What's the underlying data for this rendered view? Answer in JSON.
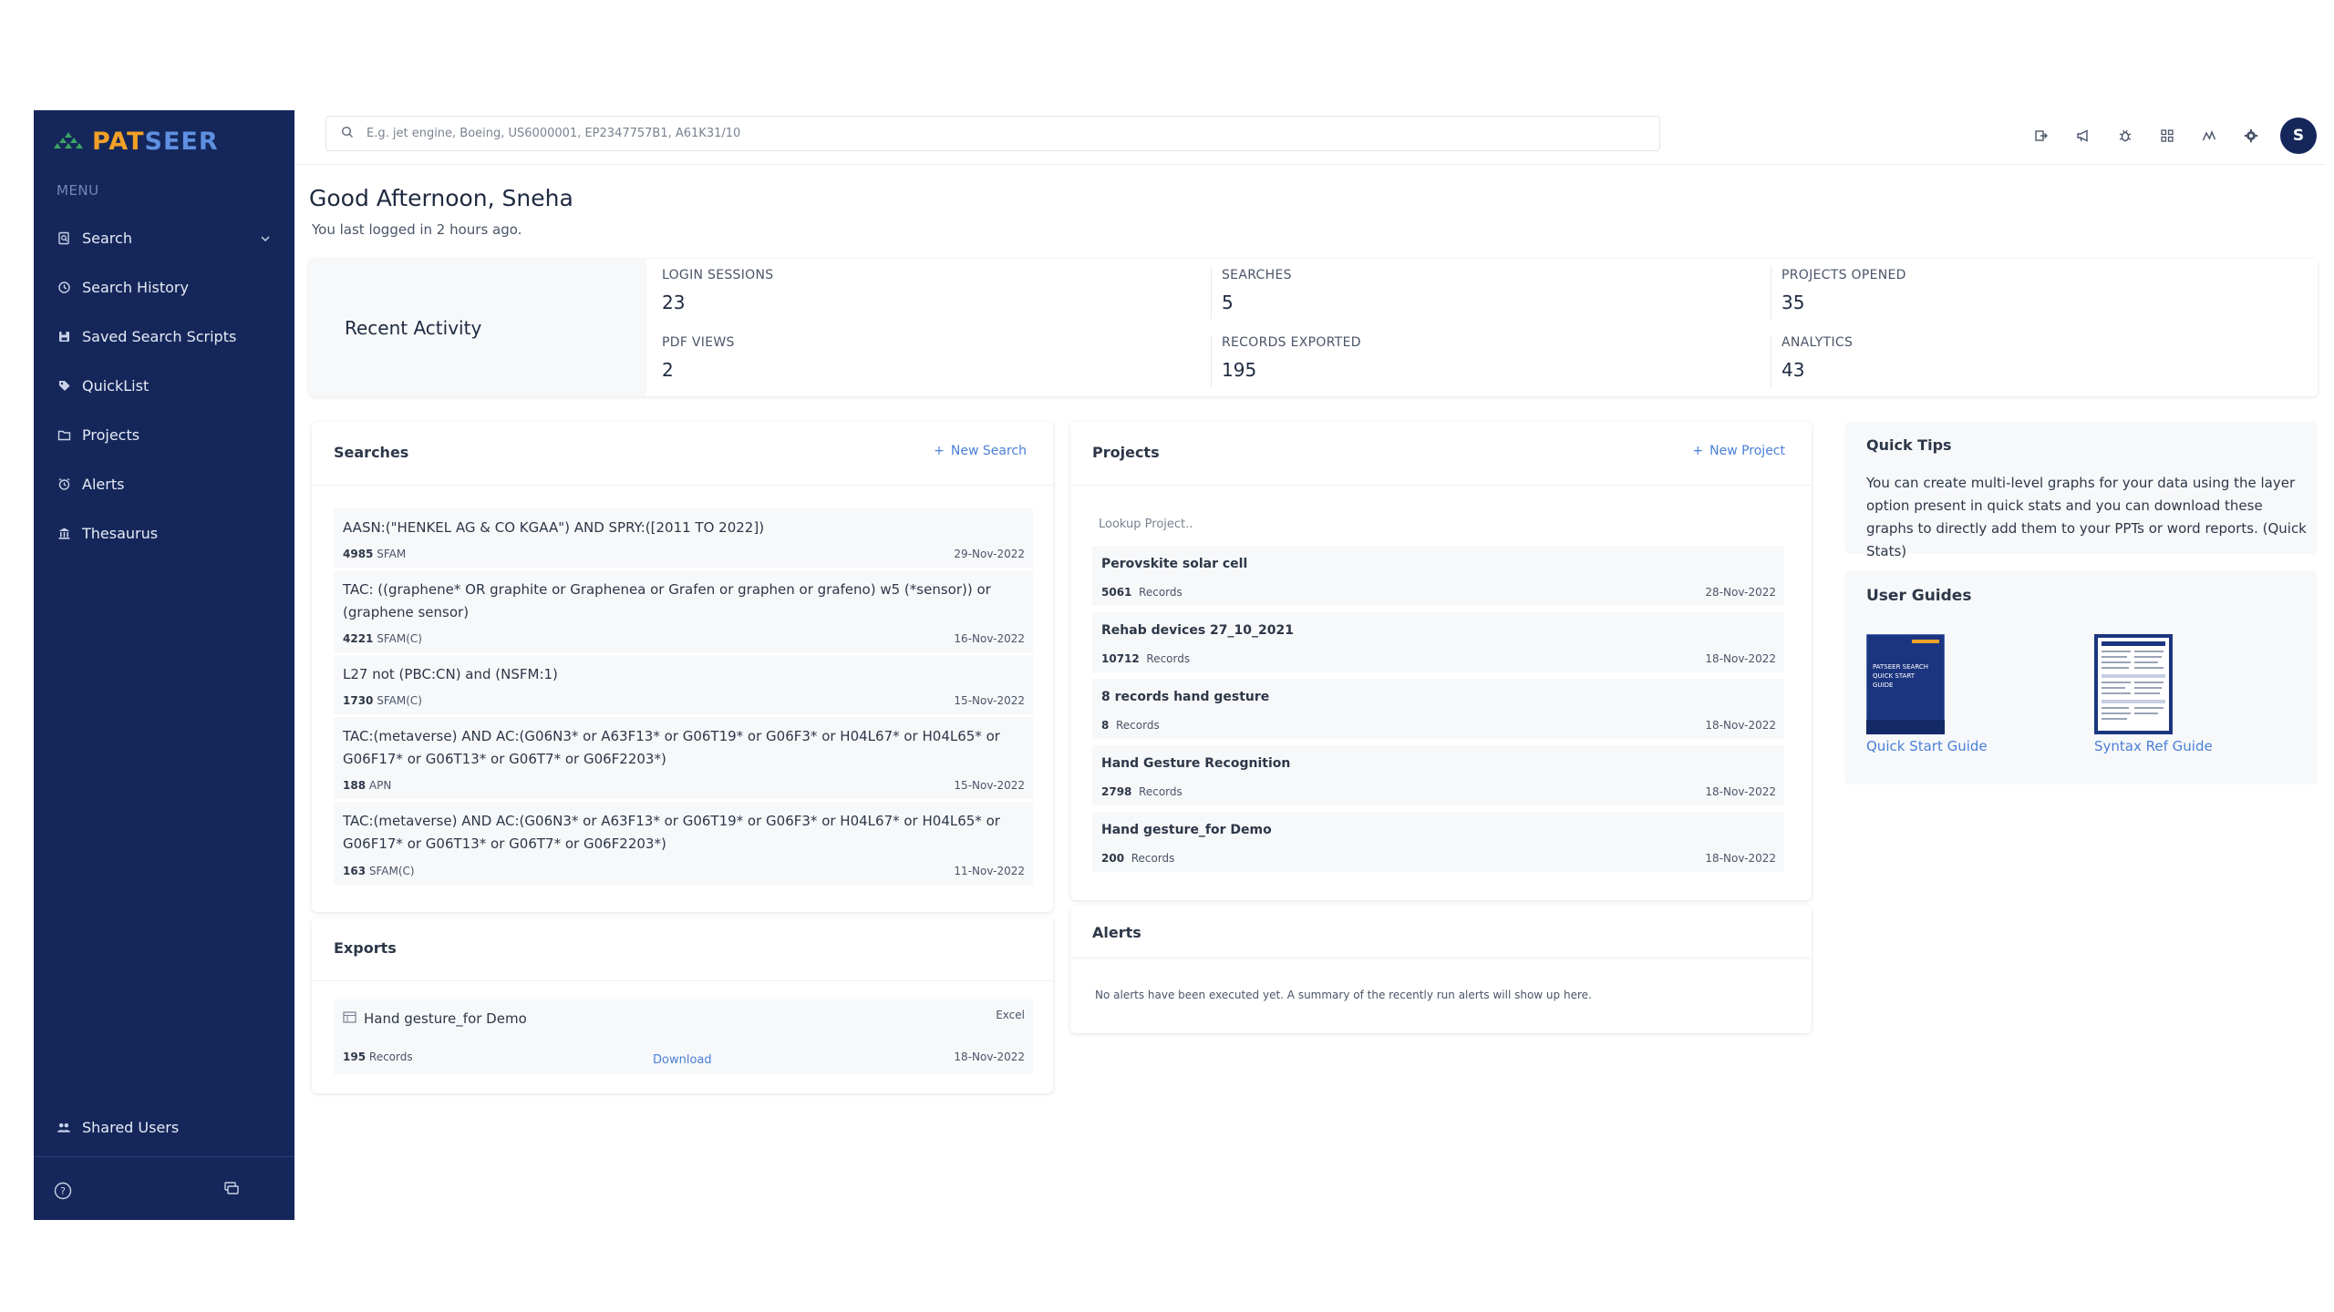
{
  "sidebar": {
    "logo_pat": "PAT",
    "logo_seer": "SEER",
    "menu_heading": "MENU",
    "items": [
      {
        "label": "Search",
        "icon": "search-doc-icon"
      },
      {
        "label": "Search History",
        "icon": "history-icon"
      },
      {
        "label": "Saved Search Scripts",
        "icon": "save-icon"
      },
      {
        "label": "QuickList",
        "icon": "tag-icon"
      },
      {
        "label": "Projects",
        "icon": "folder-icon"
      },
      {
        "label": "Alerts",
        "icon": "alarm-icon"
      },
      {
        "label": "Thesaurus",
        "icon": "bank-icon"
      }
    ],
    "shared_users": "Shared Users"
  },
  "topbar": {
    "search_placeholder": "E.g. jet engine, Boeing, US6000001, EP2347757B1, A61K31/10",
    "avatar_initial": "S"
  },
  "greeting": {
    "title": "Good Afternoon, Sneha",
    "last_login": "You last logged in 2 hours ago."
  },
  "recent_activity": {
    "title": "Recent Activity",
    "stats": [
      {
        "label": "LOGIN SESSIONS",
        "value": "23"
      },
      {
        "label": "SEARCHES",
        "value": "5"
      },
      {
        "label": "PROJECTS OPENED",
        "value": "35"
      },
      {
        "label": "PDF VIEWS",
        "value": "2"
      },
      {
        "label": "RECORDS EXPORTED",
        "value": "195"
      },
      {
        "label": "ANALYTICS",
        "value": "43"
      }
    ]
  },
  "searches": {
    "title": "Searches",
    "action": "New Search",
    "items": [
      {
        "line1": "AASN:(\"HENKEL AG & CO KGAA\") AND SPRY:([2011 TO 2022])",
        "line2": "",
        "count": "4985",
        "unit": "SFAM",
        "date": "29-Nov-2022"
      },
      {
        "line1": "TAC: ((graphene* OR graphite or Graphenea or Grafen or graphen or grafeno) w5 (*sensor)) or",
        "line2": "(graphene sensor)",
        "count": "4221",
        "unit": "SFAM(C)",
        "date": "16-Nov-2022"
      },
      {
        "line1": "L27 not (PBC:CN) and (NSFM:1)",
        "line2": "",
        "count": "1730",
        "unit": "SFAM(C)",
        "date": "15-Nov-2022"
      },
      {
        "line1": "TAC:(metaverse) AND AC:(G06N3* or A63F13* or G06T19* or G06F3* or H04L67* or H04L65* or",
        "line2": "G06F17* or G06T13* or G06T7* or G06F2203*)",
        "count": "188",
        "unit": "APN",
        "date": "15-Nov-2022"
      },
      {
        "line1": "TAC:(metaverse) AND AC:(G06N3* or A63F13* or G06T19* or G06F3* or H04L67* or H04L65* or",
        "line2": "G06F17* or G06T13* or G06T7* or G06F2203*)",
        "count": "163",
        "unit": "SFAM(C)",
        "date": "11-Nov-2022"
      }
    ]
  },
  "exports": {
    "title": "Exports",
    "item": {
      "name": "Hand gesture_for Demo",
      "type": "Excel",
      "count": "195",
      "unit": "Records",
      "action": "Download",
      "date": "18-Nov-2022"
    }
  },
  "projects": {
    "title": "Projects",
    "action": "New Project",
    "lookup_placeholder": "Lookup Project..",
    "items": [
      {
        "name": "Perovskite solar cell",
        "count": "5061",
        "unit": "Records",
        "date": "28-Nov-2022"
      },
      {
        "name": "Rehab devices 27_10_2021",
        "count": "10712",
        "unit": "Records",
        "date": "18-Nov-2022"
      },
      {
        "name": "8 records hand gesture",
        "count": "8",
        "unit": "Records",
        "date": "18-Nov-2022"
      },
      {
        "name": "Hand Gesture Recognition",
        "count": "2798",
        "unit": "Records",
        "date": "18-Nov-2022"
      },
      {
        "name": "Hand gesture_for Demo",
        "count": "200",
        "unit": "Records",
        "date": "18-Nov-2022"
      }
    ]
  },
  "alerts": {
    "title": "Alerts",
    "empty_message": "No alerts have been executed yet. A summary of the recently run alerts will show up here."
  },
  "quick_tips": {
    "title": "Quick Tips",
    "text": "You can create multi-level graphs for your data using the layer option present in quick stats and you can download these graphs to directly add them to your PPTs or word reports. (Quick Stats)"
  },
  "user_guides": {
    "title": "User Guides",
    "items": [
      {
        "label": "Quick Start Guide",
        "cover_text": "PATSEER SEARCH QUICK START GUIDE"
      },
      {
        "label": "Syntax Ref Guide",
        "cover_text": ""
      }
    ]
  },
  "colors": {
    "sidebar_bg": "#15275a",
    "logo_orange": "#f2a027",
    "logo_blue": "#5f8fe0",
    "link_blue": "#4a7fd8"
  }
}
